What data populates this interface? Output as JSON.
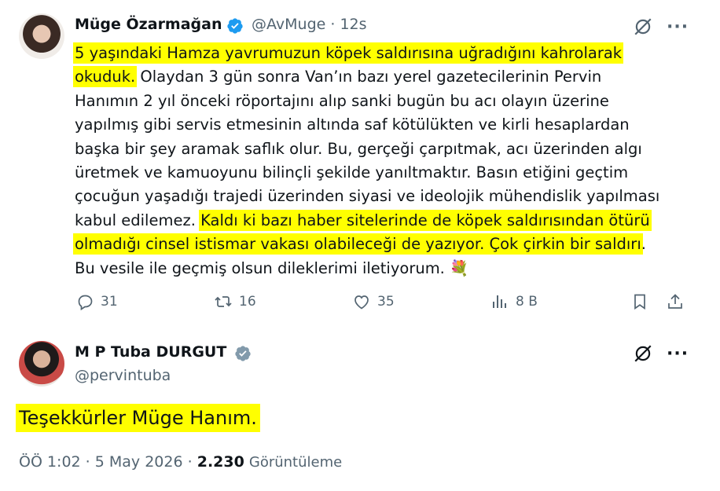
{
  "tweet": {
    "author_name": "Müge Özarmağan",
    "author_handle": "@AvMuge",
    "time_ago": "12s",
    "lines": [
      [
        {
          "text": "5 yaşındaki Hamza yavrumuzun köpek saldırısına uğradığını kahrolarak",
          "hl": true
        }
      ],
      [
        {
          "text": "okuduk.",
          "hl": true
        },
        {
          "text": " Olaydan 3 gün sonra Van’ın bazı yerel gazetecilerinin Pervin",
          "hl": false
        }
      ],
      [
        {
          "text": "Hanımın 2 yıl önceki röportajını alıp sanki bugün bu acı olayın üzerine",
          "hl": false
        }
      ],
      [
        {
          "text": "yapılmış gibi servis etmesinin altında saf kötülükten ve kirli hesaplardan",
          "hl": false
        }
      ],
      [
        {
          "text": "başka bir şey aramak saflık olur. Bu, gerçeği çarpıtmak, acı üzerinden algı",
          "hl": false
        }
      ],
      [
        {
          "text": "üretmek ve kamuoyunu bilinçli şekilde yanıltmaktır. Basın etiğini geçtim",
          "hl": false
        }
      ],
      [
        {
          "text": "çocuğun yaşadığı trajedi üzerinden siyasi ve ideolojik mühendislik yapılması",
          "hl": false
        }
      ],
      [
        {
          "text": "kabul edilemez. ",
          "hl": false
        },
        {
          "text": "Kaldı ki bazı haber sitelerinde de köpek saldırısından ötürü",
          "hl": true
        }
      ],
      [
        {
          "text": "olmadığı cinsel istismar vakası olabileceği de yazıyor. Çok çirkin bir saldırı",
          "hl": true
        },
        {
          "text": ".",
          "hl": false
        }
      ],
      [
        {
          "text": "Bu vesile ile geçmiş olsun dileklerimi iletiyorum. 💐",
          "hl": false
        }
      ]
    ],
    "stats": {
      "replies": "31",
      "retweets": "16",
      "likes": "35",
      "views": "8 B"
    }
  },
  "reply": {
    "author_name": "M P Tuba DURGUT",
    "author_handle": "@pervintuba",
    "text": "Teşekkürler Müge Hanım.",
    "time": "ÖÖ 1:02",
    "date": "5 May 2026",
    "views_count": "2.230",
    "views_label": "Görüntüleme",
    "separator": "·"
  },
  "colors": {
    "highlight": "#ffff00",
    "verified_blue": "#1d9bf0",
    "verified_gray": "#829aab",
    "muted": "#536471"
  }
}
